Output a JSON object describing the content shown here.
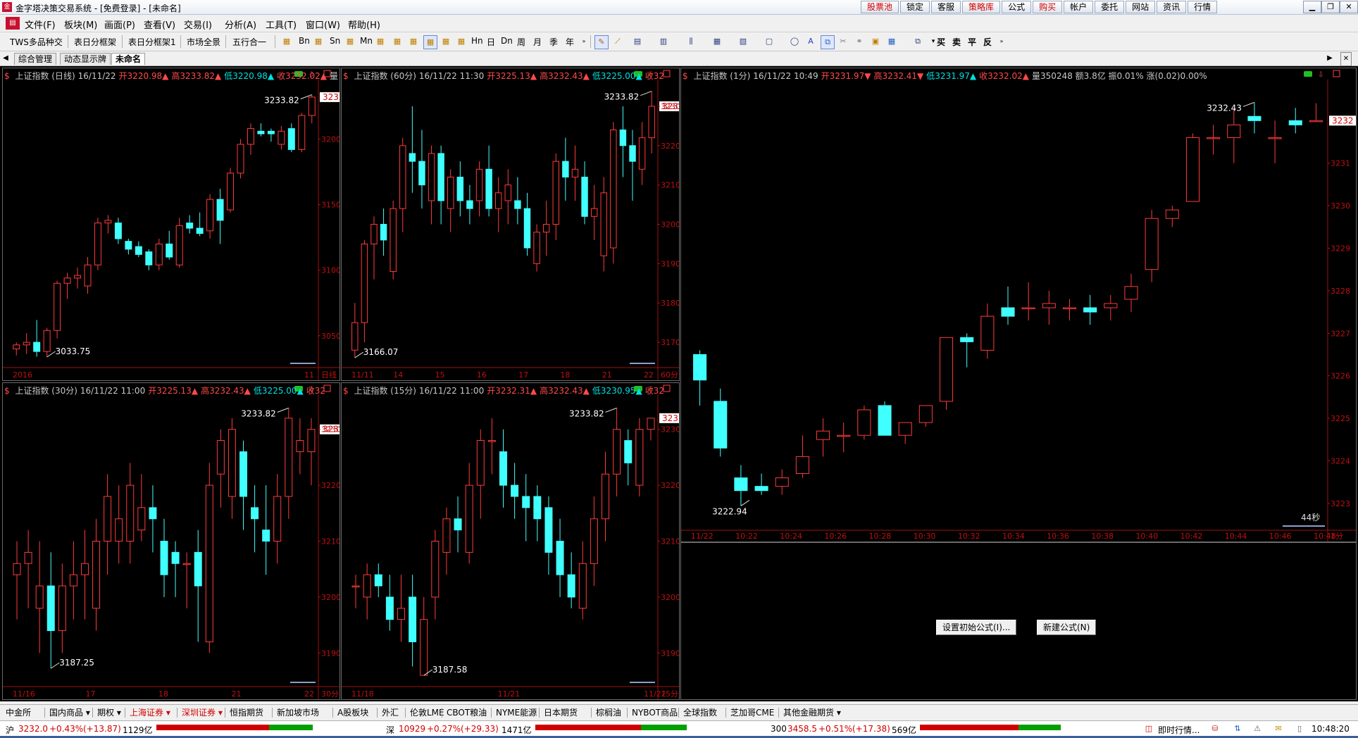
{
  "window": {
    "title": "金字塔决策交易系统 - [免费登录] - [未命名]",
    "icon": "app-logo-icon",
    "top_buttons": [
      {
        "label": "股票池",
        "color": "red"
      },
      {
        "label": "锁定",
        "color": "black"
      },
      {
        "label": "客服",
        "color": "black"
      },
      {
        "label": "策略库",
        "color": "red"
      },
      {
        "label": "公式",
        "color": "black"
      },
      {
        "label": "购买",
        "color": "red"
      },
      {
        "label": "帐户",
        "color": "black"
      },
      {
        "label": "委托",
        "color": "black"
      },
      {
        "label": "网站",
        "color": "black"
      },
      {
        "label": "资讯",
        "color": "black"
      },
      {
        "label": "行情",
        "color": "black"
      }
    ],
    "controls": {
      "minimize": "▁",
      "restore": "❐",
      "close": "✕"
    }
  },
  "menu": [
    "文件(F)",
    "板块(M)",
    "画面(P)",
    "查看(V)",
    "交易(I)",
    "分析(A)",
    "工具(T)",
    "窗口(W)",
    "帮助(H)"
  ],
  "toolbar": {
    "text_buttons": [
      "TWS多品种交",
      "表日分框架",
      "表日分框架1",
      "市场全景",
      "五行合一"
    ],
    "periods": [
      "Bn",
      "Sn",
      "Mn",
      "Dn",
      "日",
      "周",
      "月",
      "季",
      "年",
      "Hn"
    ],
    "trade_labels": [
      "买",
      "卖",
      "平",
      "反"
    ]
  },
  "tabs": [
    "综合管理",
    "动态显示牌",
    "未命名"
  ],
  "panels": [
    {
      "id": "daily",
      "name": "上证指数 (日线)",
      "date": "16/11/22",
      "open": "开3220.98▲",
      "high": "高3233.82▲",
      "low": "低3220.98▲",
      "close": "收3232.02▲",
      "extra": "量",
      "hi_label": "3233.82",
      "lo_label": "3033.75",
      "price_tag": "3232",
      "y_labels": [
        "3200",
        "3150",
        "3100",
        "3050"
      ],
      "x_labels": [
        "2016",
        "11"
      ],
      "period_label": "日线"
    },
    {
      "id": "m60",
      "name": "上证指数 (60分)",
      "date": "16/11/22 11:30",
      "open": "开3225.13▲",
      "high": "高3232.43▲",
      "low": "低3225.00▲",
      "close": "收32",
      "extra": "",
      "hi_label": "3233.82",
      "lo_label": "3166.07",
      "price_tag": "3232",
      "y_labels": [
        "3230",
        "3220",
        "3210",
        "3200",
        "3190",
        "3180",
        "3170"
      ],
      "x_labels": [
        "11/11",
        "14",
        "15",
        "16",
        "17",
        "18",
        "21",
        "22"
      ],
      "period_label": "60分"
    },
    {
      "id": "m30",
      "name": "上证指数 (30分)",
      "date": "16/11/22 11:00",
      "open": "开3225.13▲",
      "high": "高3232.43▲",
      "low": "低3225.00▲",
      "close": "收32",
      "extra": "",
      "hi_label": "3233.82",
      "lo_label": "3187.25",
      "price_tag": "3232",
      "y_labels": [
        "3230",
        "3220",
        "3210",
        "3200",
        "3190"
      ],
      "x_labels": [
        "11/16",
        "17",
        "18",
        "21",
        "22"
      ],
      "period_label": "30分"
    },
    {
      "id": "m15",
      "name": "上证指数 (15分)",
      "date": "16/11/22 11:00",
      "open": "开3232.31▲",
      "high": "高3232.43▲",
      "low": "低3230.95▲",
      "close": "收32",
      "extra": "",
      "hi_label": "3233.82",
      "lo_label": "3187.58",
      "price_tag": "3232",
      "y_labels": [
        "3230",
        "3220",
        "3210",
        "3200",
        "3190"
      ],
      "x_labels": [
        "11/18",
        "11/21",
        "11/22"
      ],
      "period_label": "15分"
    },
    {
      "id": "m1",
      "name": "上证指数 (1分)",
      "date": "16/11/22 10:49",
      "open": "开3231.97▼",
      "high": "高3232.41▼",
      "low": "低3231.97▲",
      "close": "收3232.02▲",
      "extra": "量350248 额3.8亿 振0.01% 涨(0.02)0.00%",
      "hi_label": "3232.43",
      "lo_label": "3222.94",
      "price_tag": "3232",
      "countdown": "44秒",
      "y_labels": [
        "3231",
        "3230",
        "3229",
        "3228",
        "3227",
        "3226",
        "3225",
        "3224",
        "3223"
      ],
      "x_labels": [
        "11/22",
        "10:22",
        "10:24",
        "10:26",
        "10:28",
        "10:30",
        "10:32",
        "10:34",
        "10:36",
        "10:38",
        "10:40",
        "10:42",
        "10:44",
        "10:46",
        "10:48"
      ],
      "period_label": "1分"
    }
  ],
  "chart_data": [
    {
      "type": "candlestick",
      "title": "上证指数 (日线)",
      "ylim": [
        3030,
        3240
      ],
      "candles": [
        [
          3040,
          3045,
          3035,
          3043
        ],
        [
          3043,
          3052,
          3036,
          3045
        ],
        [
          3045,
          3062,
          3034,
          3038
        ],
        [
          3038,
          3056,
          3033.75,
          3054
        ],
        [
          3054,
          3092,
          3048,
          3090
        ],
        [
          3090,
          3098,
          3078,
          3094
        ],
        [
          3094,
          3102,
          3086,
          3096
        ],
        [
          3088,
          3110,
          3082,
          3104
        ],
        [
          3104,
          3140,
          3100,
          3136
        ],
        [
          3136,
          3142,
          3128,
          3138
        ],
        [
          3136,
          3140,
          3120,
          3124
        ],
        [
          3122,
          3124,
          3112,
          3116
        ],
        [
          3118,
          3122,
          3110,
          3112
        ],
        [
          3114,
          3116,
          3100,
          3104
        ],
        [
          3104,
          3124,
          3100,
          3120
        ],
        [
          3120,
          3130,
          3108,
          3110
        ],
        [
          3104,
          3140,
          3102,
          3134
        ],
        [
          3136,
          3142,
          3128,
          3132
        ],
        [
          3132,
          3144,
          3126,
          3128
        ],
        [
          3130,
          3158,
          3124,
          3154
        ],
        [
          3154,
          3162,
          3120,
          3138
        ],
        [
          3146,
          3178,
          3144,
          3174
        ],
        [
          3174,
          3200,
          3170,
          3196
        ],
        [
          3196,
          3212,
          3188,
          3208
        ],
        [
          3206,
          3212,
          3202,
          3204
        ],
        [
          3206,
          3208,
          3198,
          3204
        ],
        [
          3196,
          3210,
          3192,
          3206
        ],
        [
          3208,
          3212,
          3190,
          3192
        ],
        [
          3192,
          3220,
          3190,
          3218
        ],
        [
          3218,
          3233.82,
          3212,
          3232
        ]
      ]
    },
    {
      "type": "candlestick",
      "title": "上证指数 (60分)",
      "ylim": [
        3165,
        3235
      ],
      "candles": [
        [
          3168,
          3180,
          3166.07,
          3175
        ],
        [
          3175,
          3196,
          3170,
          3195
        ],
        [
          3195,
          3202,
          3186,
          3200
        ],
        [
          3200,
          3204,
          3192,
          3196
        ],
        [
          3188,
          3206,
          3186,
          3204
        ],
        [
          3204,
          3222,
          3198,
          3220
        ],
        [
          3218,
          3230,
          3208,
          3216
        ],
        [
          3216,
          3224,
          3204,
          3210
        ],
        [
          3206,
          3220,
          3200,
          3218
        ],
        [
          3218,
          3220,
          3200,
          3206
        ],
        [
          3204,
          3214,
          3198,
          3212
        ],
        [
          3212,
          3216,
          3202,
          3206
        ],
        [
          3206,
          3210,
          3200,
          3204
        ],
        [
          3206,
          3216,
          3202,
          3214
        ],
        [
          3214,
          3220,
          3202,
          3204
        ],
        [
          3204,
          3212,
          3198,
          3208
        ],
        [
          3206,
          3214,
          3200,
          3210
        ],
        [
          3206,
          3212,
          3200,
          3204
        ],
        [
          3204,
          3208,
          3192,
          3194
        ],
        [
          3190,
          3200,
          3188,
          3198
        ],
        [
          3198,
          3206,
          3192,
          3200
        ],
        [
          3200,
          3218,
          3196,
          3216
        ],
        [
          3216,
          3222,
          3206,
          3212
        ],
        [
          3212,
          3220,
          3206,
          3214
        ],
        [
          3212,
          3216,
          3200,
          3202
        ],
        [
          3202,
          3210,
          3196,
          3204
        ],
        [
          3192,
          3212,
          3188,
          3208
        ],
        [
          3194,
          3226,
          3190,
          3224
        ],
        [
          3224,
          3230,
          3212,
          3220
        ],
        [
          3220,
          3224,
          3206,
          3216
        ],
        [
          3214,
          3226,
          3210,
          3222
        ],
        [
          3222,
          3233.82,
          3218,
          3230
        ]
      ]
    },
    {
      "type": "candlestick",
      "title": "上证指数 (30分)",
      "ylim": [
        3185,
        3235
      ],
      "candles": [
        [
          3204,
          3210,
          3196,
          3206
        ],
        [
          3206,
          3212,
          3198,
          3208
        ],
        [
          3198,
          3210,
          3190,
          3202
        ],
        [
          3202,
          3208,
          3187.25,
          3194
        ],
        [
          3194,
          3206,
          3190,
          3202
        ],
        [
          3202,
          3210,
          3196,
          3204
        ],
        [
          3204,
          3212,
          3196,
          3206
        ],
        [
          3198,
          3214,
          3194,
          3210
        ],
        [
          3210,
          3222,
          3204,
          3218
        ],
        [
          3210,
          3220,
          3206,
          3214
        ],
        [
          3210,
          3224,
          3206,
          3220
        ],
        [
          3212,
          3222,
          3210,
          3216
        ],
        [
          3216,
          3220,
          3208,
          3214
        ],
        [
          3210,
          3214,
          3200,
          3204
        ],
        [
          3208,
          3210,
          3200,
          3206
        ],
        [
          3206,
          3208,
          3198,
          3206
        ],
        [
          3208,
          3212,
          3192,
          3202
        ],
        [
          3192,
          3224,
          3190,
          3220
        ],
        [
          3222,
          3230,
          3216,
          3228
        ],
        [
          3218,
          3232,
          3214,
          3230
        ],
        [
          3226,
          3228,
          3212,
          3218
        ],
        [
          3216,
          3220,
          3208,
          3214
        ],
        [
          3212,
          3220,
          3204,
          3210
        ],
        [
          3210,
          3222,
          3206,
          3218
        ],
        [
          3218,
          3233.82,
          3214,
          3232
        ],
        [
          3226,
          3232,
          3222,
          3228
        ],
        [
          3226,
          3232,
          3220,
          3230
        ]
      ]
    },
    {
      "type": "candlestick",
      "title": "上证指数 (15分)",
      "ylim": [
        3185,
        3235
      ],
      "candles": [
        [
          3202,
          3204,
          3198,
          3202
        ],
        [
          3200,
          3206,
          3196,
          3204
        ],
        [
          3204,
          3206,
          3200,
          3202
        ],
        [
          3200,
          3204,
          3194,
          3196
        ],
        [
          3196,
          3204,
          3192,
          3198
        ],
        [
          3200,
          3204,
          3187.58,
          3192
        ],
        [
          3186,
          3200,
          3186,
          3196
        ],
        [
          3200,
          3212,
          3196,
          3210
        ],
        [
          3208,
          3216,
          3204,
          3214
        ],
        [
          3214,
          3218,
          3208,
          3212
        ],
        [
          3208,
          3224,
          3206,
          3220
        ],
        [
          3220,
          3230,
          3214,
          3228
        ],
        [
          3228,
          3232,
          3222,
          3228
        ],
        [
          3226,
          3230,
          3216,
          3220
        ],
        [
          3220,
          3224,
          3214,
          3218
        ],
        [
          3218,
          3222,
          3210,
          3216
        ],
        [
          3218,
          3220,
          3210,
          3214
        ],
        [
          3216,
          3218,
          3204,
          3208
        ],
        [
          3210,
          3214,
          3200,
          3204
        ],
        [
          3204,
          3208,
          3198,
          3200
        ],
        [
          3198,
          3210,
          3196,
          3206
        ],
        [
          3206,
          3218,
          3202,
          3214
        ],
        [
          3214,
          3226,
          3210,
          3222
        ],
        [
          3222,
          3233.82,
          3218,
          3230
        ],
        [
          3228,
          3230,
          3220,
          3224
        ],
        [
          3220,
          3232,
          3218,
          3230
        ],
        [
          3230,
          3232,
          3228,
          3232
        ]
      ]
    },
    {
      "type": "candlestick",
      "title": "上证指数 (1分)",
      "ylim": [
        3222.5,
        3232.8
      ],
      "candles": [
        [
          3226.5,
          3226.6,
          3225.3,
          3225.9
        ],
        [
          3225.4,
          3225.7,
          3224.1,
          3224.3
        ],
        [
          3223.6,
          3223.9,
          3222.94,
          3223.3
        ],
        [
          3223.4,
          3223.7,
          3223.2,
          3223.3
        ],
        [
          3223.4,
          3223.8,
          3223.2,
          3223.6
        ],
        [
          3223.7,
          3224.6,
          3223.6,
          3224.1
        ],
        [
          3224.5,
          3225.0,
          3224.1,
          3224.7
        ],
        [
          3224.6,
          3224.9,
          3224.2,
          3224.6
        ],
        [
          3224.6,
          3225.3,
          3224.5,
          3225.2
        ],
        [
          3225.3,
          3225.4,
          3224.7,
          3224.6
        ],
        [
          3224.6,
          3224.9,
          3224.4,
          3224.9
        ],
        [
          3224.9,
          3225.3,
          3224.8,
          3225.3
        ],
        [
          3225.4,
          3226.9,
          3225.2,
          3226.9
        ],
        [
          3226.9,
          3227.0,
          3226.2,
          3226.8
        ],
        [
          3226.6,
          3227.7,
          3226.4,
          3227.4
        ],
        [
          3227.6,
          3228.1,
          3227.2,
          3227.4
        ],
        [
          3227.6,
          3228.2,
          3227.3,
          3227.6
        ],
        [
          3227.6,
          3228.0,
          3227.2,
          3227.7
        ],
        [
          3227.6,
          3227.8,
          3227.3,
          3227.6
        ],
        [
          3227.6,
          3227.9,
          3227.2,
          3227.5
        ],
        [
          3227.6,
          3227.9,
          3227.3,
          3227.7
        ],
        [
          3227.8,
          3228.4,
          3227.5,
          3228.1
        ],
        [
          3228.5,
          3229.9,
          3228.2,
          3229.7
        ],
        [
          3229.7,
          3230.0,
          3229.5,
          3229.9
        ],
        [
          3230.1,
          3231.7,
          3230.1,
          3231.6
        ],
        [
          3231.6,
          3231.9,
          3231.2,
          3231.6
        ],
        [
          3231.6,
          3232.3,
          3231.0,
          3231.9
        ],
        [
          3232.1,
          3232.43,
          3231.7,
          3232.0
        ],
        [
          3231.6,
          3232.0,
          3231.0,
          3231.6
        ],
        [
          3232.0,
          3232.3,
          3231.7,
          3231.9
        ],
        [
          3232.0,
          3232.41,
          3231.97,
          3232.0
        ]
      ]
    }
  ],
  "formula_buttons": [
    "设置初始公式(I)...",
    "新建公式(N)"
  ],
  "bottom_tabs": [
    "中金所",
    "国内商品 ▾",
    "期权 ▾",
    "上海证券 ▾",
    "深圳证券 ▾",
    "恒指期货",
    "新加坡市场",
    "A股板块",
    "外汇",
    "伦敦LME",
    "CBOT粮油",
    "NYME能源",
    "日本期货",
    "棕榈油",
    "NYBOT商品",
    "全球指数",
    "芝加哥CME",
    "其他金融期货 ▾"
  ],
  "status": {
    "sh": {
      "name": "沪",
      "price": "3232.0",
      "pct": "+0.43%",
      "chg": "(+13.87)",
      "amt": "1129亿"
    },
    "sz": {
      "name": "深",
      "price": "10929",
      "pct": "+0.27%",
      "chg": "(+29.33)",
      "amt": "1471亿"
    },
    "hs300": {
      "name": "300",
      "price": "3458.5",
      "pct": "+0.51%",
      "chg": "(+17.38)",
      "amt": "569亿"
    },
    "realtime": "即时行情...",
    "time": "10:48:20"
  },
  "colors": {
    "up": "#ff3b3b",
    "down": "#40ffff",
    "background": "#000000",
    "axis_text": "#c01010"
  }
}
